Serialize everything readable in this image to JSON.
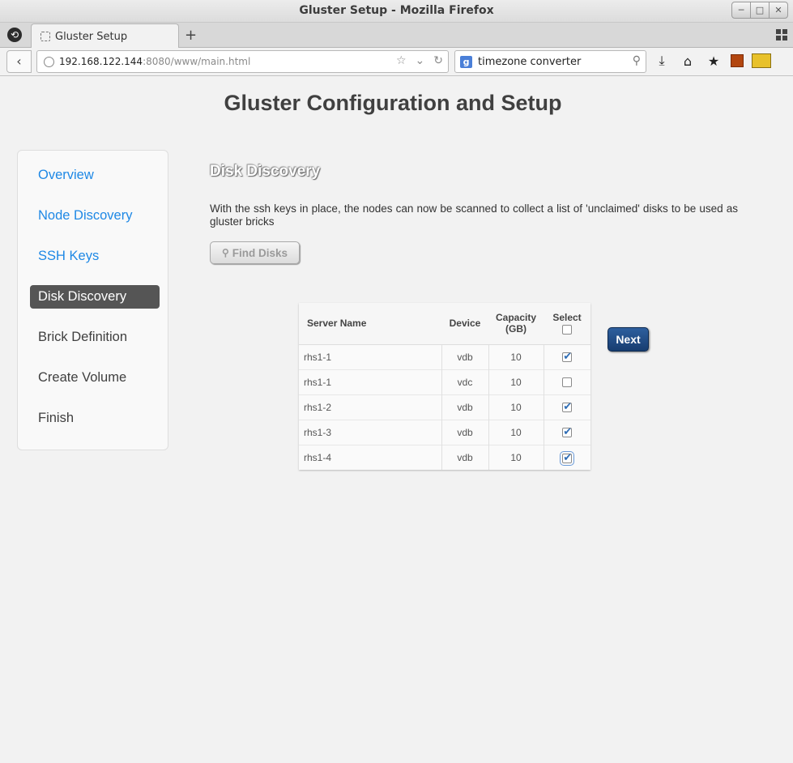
{
  "window": {
    "title": "Gluster Setup - Mozilla Firefox"
  },
  "tabs": [
    {
      "label": "Gluster Setup"
    }
  ],
  "navbar": {
    "url_host": "192.168.122.144",
    "url_rest": ":8080/www/main.html",
    "search_query": "timezone converter"
  },
  "page": {
    "title": "Gluster Configuration and Setup",
    "sidebar": [
      {
        "label": "Overview",
        "state": "link"
      },
      {
        "label": "Node Discovery",
        "state": "link"
      },
      {
        "label": "SSH Keys",
        "state": "link"
      },
      {
        "label": "Disk Discovery",
        "state": "active"
      },
      {
        "label": "Brick Definition",
        "state": "plain"
      },
      {
        "label": "Create Volume",
        "state": "plain"
      },
      {
        "label": "Finish",
        "state": "plain"
      }
    ],
    "section_title": "Disk Discovery",
    "description": "With the ssh keys in place, the nodes can now be scanned to collect a list of 'unclaimed' disks to be used as gluster bricks",
    "find_button": "Find Disks",
    "next_button": "Next",
    "table": {
      "columns": [
        "Server Name",
        "Device",
        "Capacity (GB)",
        "Select"
      ],
      "rows": [
        {
          "server": "rhs1-1",
          "device": "vdb",
          "capacity": "10",
          "selected": true
        },
        {
          "server": "rhs1-1",
          "device": "vdc",
          "capacity": "10",
          "selected": false
        },
        {
          "server": "rhs1-2",
          "device": "vdb",
          "capacity": "10",
          "selected": true
        },
        {
          "server": "rhs1-3",
          "device": "vdb",
          "capacity": "10",
          "selected": true
        },
        {
          "server": "rhs1-4",
          "device": "vdb",
          "capacity": "10",
          "selected": true
        }
      ]
    }
  }
}
